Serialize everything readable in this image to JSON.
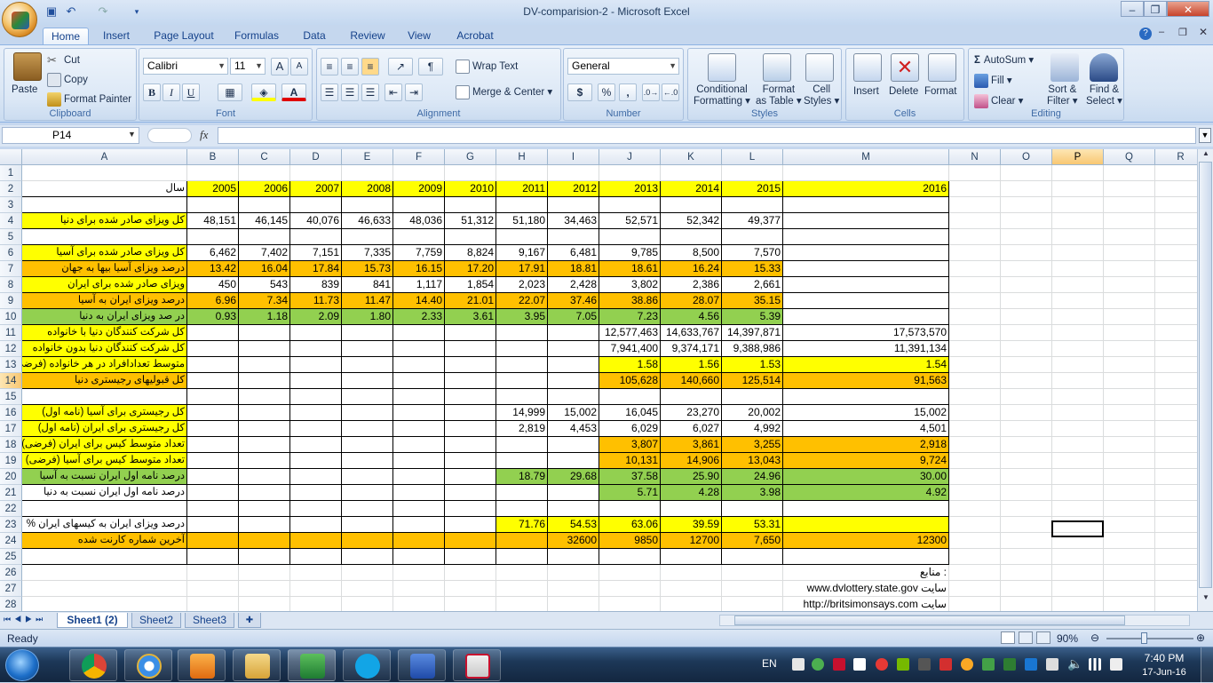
{
  "window": {
    "title": "DV-comparision-2 - Microsoft Excel",
    "minimize": "‒",
    "restore": "❐",
    "close": "✕"
  },
  "ribbon_tabs": [
    "Home",
    "Insert",
    "Page Layout",
    "Formulas",
    "Data",
    "Review",
    "View",
    "Acrobat"
  ],
  "clipboard": {
    "paste": "Paste",
    "cut": "Cut",
    "copy": "Copy",
    "format_painter": "Format Painter",
    "label": "Clipboard"
  },
  "font": {
    "name": "Calibri",
    "size": "11",
    "bold": "B",
    "italic": "I",
    "underline": "U",
    "label": "Font"
  },
  "alignment": {
    "wrap": "Wrap Text",
    "merge": "Merge & Center",
    "label": "Alignment"
  },
  "number": {
    "format": "General",
    "currency": "$",
    "percent": "%",
    "comma": ",",
    "label": "Number"
  },
  "styles": {
    "cond": "Conditional",
    "cond2": "Formatting",
    "fmt_table": "Format",
    "fmt_table2": "as Table",
    "cell_styles": "Cell",
    "cell_styles2": "Styles",
    "label": "Styles"
  },
  "cells": {
    "insert": "Insert",
    "delete": "Delete",
    "format": "Format",
    "label": "Cells"
  },
  "editing": {
    "autosum": "AutoSum",
    "fill": "Fill",
    "clear": "Clear",
    "sort": "Sort &",
    "sort2": "Filter",
    "find": "Find &",
    "find2": "Select",
    "label": "Editing"
  },
  "formula_bar": {
    "name_box": "P14",
    "fx": "fx",
    "formula": ""
  },
  "columns": [
    "A",
    "B",
    "C",
    "D",
    "E",
    "F",
    "G",
    "H",
    "I",
    "J",
    "K",
    "L",
    "M",
    "N",
    "O",
    "P",
    "Q",
    "R"
  ],
  "rows": [
    {
      "n": "1",
      "cells": {}
    },
    {
      "n": "2",
      "cells": {
        "A": "سال",
        "B": "2005",
        "C": "2006",
        "D": "2007",
        "E": "2008",
        "F": "2009",
        "G": "2010",
        "H": "2011",
        "I": "2012",
        "J": "2013",
        "K": "2014",
        "L": "2015",
        "M": "2016"
      }
    },
    {
      "n": "3",
      "cells": {}
    },
    {
      "n": "4",
      "cells": {
        "A": "کل ویزای صادر شده برای دنیا",
        "B": "48,151",
        "C": "46,145",
        "D": "40,076",
        "E": "46,633",
        "F": "48,036",
        "G": "51,312",
        "H": "51,180",
        "I": "34,463",
        "J": "52,571",
        "K": "52,342",
        "L": "49,377"
      }
    },
    {
      "n": "5",
      "cells": {}
    },
    {
      "n": "6",
      "cells": {
        "A": "کل ویزای صادر شده برای آسیا",
        "B": "6,462",
        "C": "7,402",
        "D": "7,151",
        "E": "7,335",
        "F": "7,759",
        "G": "8,824",
        "H": "9,167",
        "I": "6,481",
        "J": "9,785",
        "K": "8,500",
        "L": "7,570"
      }
    },
    {
      "n": "7",
      "cells": {
        "A": "درصد ویزای آسیا بیها به جهان",
        "B": "13.42",
        "C": "16.04",
        "D": "17.84",
        "E": "15.73",
        "F": "16.15",
        "G": "17.20",
        "H": "17.91",
        "I": "18.81",
        "J": "18.61",
        "K": "16.24",
        "L": "15.33"
      }
    },
    {
      "n": "8",
      "cells": {
        "A": "ویزای صادر شده برای ایران",
        "B": "450",
        "C": "543",
        "D": "839",
        "E": "841",
        "F": "1,117",
        "G": "1,854",
        "H": "2,023",
        "I": "2,428",
        "J": "3,802",
        "K": "2,386",
        "L": "2,661"
      }
    },
    {
      "n": "9",
      "cells": {
        "A": "درصد  ویزای ایران به آسیا",
        "B": "6.96",
        "C": "7.34",
        "D": "11.73",
        "E": "11.47",
        "F": "14.40",
        "G": "21.01",
        "H": "22.07",
        "I": "37.46",
        "J": "38.86",
        "K": "28.07",
        "L": "35.15"
      }
    },
    {
      "n": "10",
      "cells": {
        "A": "در صد ویزای ایران به دنیا",
        "B": "0.93",
        "C": "1.18",
        "D": "2.09",
        "E": "1.80",
        "F": "2.33",
        "G": "3.61",
        "H": "3.95",
        "I": "7.05",
        "J": "7.23",
        "K": "4.56",
        "L": "5.39"
      }
    },
    {
      "n": "11",
      "cells": {
        "A": "کل شرکت کنندگان دنیا با خانواده",
        "J": "12,577,463",
        "K": "14,633,767",
        "L": "14,397,871",
        "M": "17,573,570"
      }
    },
    {
      "n": "12",
      "cells": {
        "A": "کل شرکت کنندگان دنیا بدون خانواده",
        "J": "7,941,400",
        "K": "9,374,171",
        "L": "9,388,986",
        "M": "11,391,134"
      }
    },
    {
      "n": "13",
      "cells": {
        "A": "متوسط تعدادافراد در هر خانواده (فرضی)",
        "J": "1.58",
        "K": "1.56",
        "L": "1.53",
        "M": "1.54"
      }
    },
    {
      "n": "14",
      "cells": {
        "A": "کل قبولیهای رجیستری دنیا",
        "J": "105,628",
        "K": "140,660",
        "L": "125,514",
        "M": "91,563"
      }
    },
    {
      "n": "15",
      "cells": {}
    },
    {
      "n": "16",
      "cells": {
        "A": "کل رجیستری برای آسیا (نامه اول)",
        "H": "14,999",
        "I": "15,002",
        "J": "16,045",
        "K": "23,270",
        "L": "20,002",
        "M": "15,002"
      }
    },
    {
      "n": "17",
      "cells": {
        "A": "کل رجیستری  برای ایران (نامه اول)",
        "H": "2,819",
        "I": "4,453",
        "J": "6,029",
        "K": "6,027",
        "L": "4,992",
        "M": "4,501"
      }
    },
    {
      "n": "18",
      "cells": {
        "A": "تعداد متوسط کیس برای ایران (فرضی)",
        "J": "3,807",
        "K": "3,861",
        "L": "3,255",
        "M": "2,918"
      }
    },
    {
      "n": "19",
      "cells": {
        "A": "تعداد متوسط کیس برای آسیا (فرضی)",
        "J": "10,131",
        "K": "14,906",
        "L": "13,043",
        "M": "9,724"
      }
    },
    {
      "n": "20",
      "cells": {
        "A": "درصد نامه اول ایران نسبت به آسیا",
        "H": "18.79",
        "I": "29.68",
        "J": "37.58",
        "K": "25.90",
        "L": "24.96",
        "M": "30.00"
      }
    },
    {
      "n": "21",
      "cells": {
        "A": "درصد نامه اول ایران نسبت به دنیا",
        "J": "5.71",
        "K": "4.28",
        "L": "3.98",
        "M": "4.92"
      }
    },
    {
      "n": "22",
      "cells": {}
    },
    {
      "n": "23",
      "cells": {
        "A": "درصد ویزای ایران به کیسهای ایران   %",
        "H": "71.76",
        "I": "54.53",
        "J": "63.06",
        "K": "39.59",
        "L": "53.31"
      }
    },
    {
      "n": "24",
      "cells": {
        "A": "آخرین شماره کارنت شده",
        "I": "32600",
        "J": "9850",
        "K": "12700",
        "L": "7,650",
        "M": "12300"
      }
    },
    {
      "n": "25",
      "cells": {}
    },
    {
      "n": "26",
      "cells": {
        "M": "منابع :"
      }
    },
    {
      "n": "27",
      "cells": {
        "M": "www.dvlottery.state.gov    سایت"
      }
    },
    {
      "n": "28",
      "cells": {
        "M": "http://britsimonsays.com    سایت"
      }
    }
  ],
  "sheets": [
    "Sheet1 (2)",
    "Sheet2",
    "Sheet3"
  ],
  "status": {
    "ready": "Ready",
    "zoom": "90%"
  },
  "taskbar": {
    "lang": "EN",
    "time": "7:40 PM",
    "date": "17-Jun-16"
  },
  "colors": {
    "yellow": "#ffff00",
    "orange": "#ffc000",
    "green": "#92d050"
  }
}
